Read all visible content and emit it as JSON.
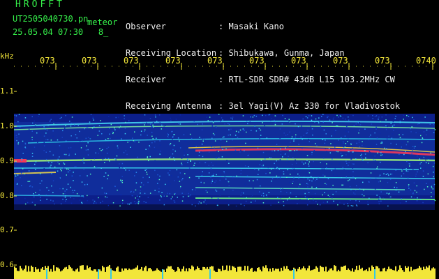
{
  "header": {
    "brand": "HROFFT",
    "filename": "UT2505040730.pn",
    "filename_suffix": "meteor",
    "datetime": "25.05.04 07:30   8_"
  },
  "info": [
    {
      "label": "Observer",
      "value": ": Masaki Kano"
    },
    {
      "label": "Receiving Location",
      "value": ": Shibukawa, Gunma, Japan"
    },
    {
      "label": "Receiver",
      "value": ": RTL-SDR SDR# 43dB L15 103.2MHz CW"
    },
    {
      "label": "Receiving Antenna",
      "value": ": 3el Yagi(V) Az 330 for Vladivostok"
    }
  ],
  "axis": {
    "unit": "kHz",
    "x_ticks": [
      "073",
      "073",
      "073",
      "073",
      "073",
      "073",
      "073",
      "073",
      "073",
      "0740"
    ],
    "y_ticks": [
      "1.1",
      "1.0",
      "0.9",
      "0.8",
      "0.7",
      "0.6"
    ]
  },
  "colors": {
    "header_text": "#35f04a",
    "tick_text": "#f2e63a",
    "info_text": "#f0f0f0"
  }
}
